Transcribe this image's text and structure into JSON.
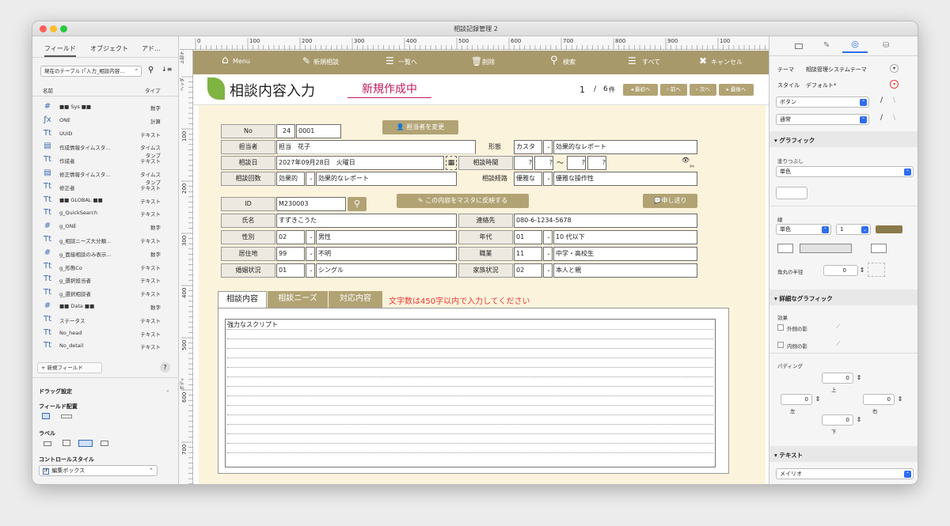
{
  "window": {
    "title": "相談記録管理 2"
  },
  "left_panel": {
    "tabs": [
      "フィールド",
      "オブジェクト",
      "アド..."
    ],
    "table_select": "現在のテーブル (「入力_相談内容...",
    "col_name": "名前",
    "col_type": "タイプ",
    "fields": [
      {
        "icon": "#",
        "name": "■■ Sys ■■",
        "type": "数字"
      },
      {
        "icon": "fx",
        "name": "ONE",
        "type": "計算"
      },
      {
        "icon": "Tt",
        "name": "UUID",
        "type": "テキスト"
      },
      {
        "icon": "ts",
        "name": "作成情報タイムスタ...",
        "type": "タイムスタンプ"
      },
      {
        "icon": "Tt",
        "name": "作成者",
        "type": "テキスト"
      },
      {
        "icon": "ts",
        "name": "修正情報タイムスタ...",
        "type": "タイムスタンプ"
      },
      {
        "icon": "Tt",
        "name": "修正者",
        "type": "テキスト"
      },
      {
        "icon": "Tt",
        "name": "■■ GLOBAL ■■",
        "type": "テキスト"
      },
      {
        "icon": "Tt",
        "name": "g_QuickSearch",
        "type": "テキスト"
      },
      {
        "icon": "#",
        "name": "g_ONE",
        "type": "数字"
      },
      {
        "icon": "Tt",
        "name": "g_相談ニーズ大分類...",
        "type": "テキスト"
      },
      {
        "icon": "#",
        "name": "g_面接相談のみ表示...",
        "type": "数字"
      },
      {
        "icon": "Tt",
        "name": "g_形態Co",
        "type": "テキスト"
      },
      {
        "icon": "Tt",
        "name": "g_選択担当者",
        "type": "テキスト"
      },
      {
        "icon": "Tt",
        "name": "g_選択相談者",
        "type": "テキスト"
      },
      {
        "icon": "#",
        "name": "■■ Data ■■",
        "type": "数字"
      },
      {
        "icon": "Tt",
        "name": "ステータス",
        "type": "テキスト"
      },
      {
        "icon": "Tt",
        "name": "No_head",
        "type": "テキスト"
      },
      {
        "icon": "Tt",
        "name": "No_detail",
        "type": "テキスト"
      }
    ],
    "new_field": "+ 新規フィールド",
    "help": "?",
    "drag_settings": "ドラッグ設定",
    "field_placement": "フィールド配置",
    "label": "ラベル",
    "control_style": "コントロールスタイル",
    "control_style_value": "編集ボックス"
  },
  "ruler": {
    "h": [
      "0",
      "100",
      "200",
      "300",
      "400",
      "500",
      "600",
      "700",
      "800",
      "900",
      "100"
    ],
    "v": [
      "100",
      "200",
      "300",
      "400",
      "500",
      "600",
      "700"
    ],
    "parts": [
      "上部ナ...",
      "ヘッダ",
      "ボディ"
    ]
  },
  "toolbar": {
    "menu": "Menu",
    "new": "新規相談",
    "list": "一覧へ",
    "delete": "削除",
    "search": "検索",
    "all": "すべて",
    "cancel": "キャンセル"
  },
  "header": {
    "title": "相談内容入力",
    "status": "新規作成中",
    "record": "1",
    "sep": "/",
    "total": "6",
    "unit": "件",
    "first": "最初へ",
    "prev": "前へ",
    "next": "次へ",
    "last": "最後へ"
  },
  "form1": {
    "no_label": "No",
    "no_value": "24",
    "no_detail": "0001",
    "change_btn": "担当者を変更",
    "tanto_label": "担当者",
    "tanto_value": "担当　花子",
    "keitai_label": "形態",
    "keitai_value": "カスタ",
    "keitai_text": "効果的なレポート",
    "date_label": "相談日",
    "date_value": "2027年09月28日　火曜日",
    "time_label": "相談時間",
    "time_sep": "～",
    "time_ph": "?",
    "count_label": "相談回数",
    "count_value": "効果的",
    "count_text": "効果的なレポート",
    "route_label": "相談経路",
    "route_value": "優雅な",
    "route_text": "優雅な操作性"
  },
  "form2": {
    "id_label": "ID",
    "id_value": "M230003",
    "reflect_btn": "この内容をマスタに反映する",
    "send_btn": "申し送り",
    "name_label": "氏名",
    "name_value": "すずきこうた",
    "tel_label": "連絡先",
    "tel_value": "080-6-1234-5678",
    "sex_label": "性別",
    "sex_code": "02",
    "sex_value": "男性",
    "age_label": "年代",
    "age_code": "01",
    "age_value": "10 代以下",
    "area_label": "居住地",
    "area_code": "99",
    "area_value": "不明",
    "job_label": "職業",
    "job_code": "11",
    "job_value": "中学・高校生",
    "marry_label": "婚姻状況",
    "marry_code": "01",
    "marry_value": "シングル",
    "family_label": "家族状況",
    "family_code": "02",
    "family_value": "本人と親"
  },
  "tabs": {
    "t1": "相談内容",
    "t2": "相談ニーズ",
    "t3": "対応内容",
    "warning": "文字数は450字以内で入力してください"
  },
  "content": {
    "text": "強力なスクリプト"
  },
  "right_panel": {
    "theme_label": "テーマ",
    "theme_value": "相談管理システムテーマ",
    "style_label": "スタイル",
    "style_value": "デフォルト*",
    "obj_select": "ボタン",
    "state_select": "通常",
    "graphic": "グラフィック",
    "fill": "塗りつぶし",
    "fill_value": "単色",
    "line": "線",
    "line_value": "単色",
    "line_width": "1",
    "radius": "角丸の半径",
    "radius_value": "0",
    "adv": "詳細なグラフィック",
    "effect": "効果",
    "outer": "外側の影",
    "inner": "内側の影",
    "padding": "パディング",
    "pad_top": "0",
    "pad_left": "0",
    "pad_right": "0",
    "pad_bottom": "0",
    "pad_top_l": "上",
    "pad_left_l": "左",
    "pad_right_l": "右",
    "pad_bottom_l": "下",
    "text": "テキスト",
    "font": "メイリオ"
  },
  "colors": {
    "accent": "#a8996b",
    "status": "#c2185b",
    "warning": "#e53935",
    "body": "#fcf3dc"
  }
}
